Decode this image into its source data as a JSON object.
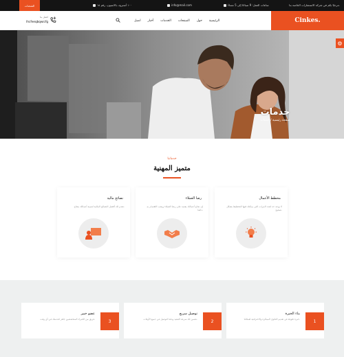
{
  "colors": {
    "accent": "#ea5121",
    "topbar": "#141414",
    "band": "#eef0f0"
  },
  "topbar": {
    "cta": "الشحنات",
    "address": "١٠٠ أسترود، بالاسيون، رقم ١٥",
    "email": "info@mail.com",
    "hours": "ساعات العمل: 9 صباحًا إلى 5 مساءً",
    "tagline": "مرحبًا بكم في شركة الاستشارات الخاصة بنا."
  },
  "header": {
    "brand": "Cinkes.",
    "nav": [
      "الرئيسية",
      "حول",
      "الصفحات",
      "الخدمات",
      "أخبار",
      "اتصل"
    ],
    "phone_label": "اتصل بنا",
    "phone": "Ihcfeeqbqwicfg"
  },
  "hero": {
    "title": "خدمات",
    "subtitle": "صفحة رئيسية / خدمات"
  },
  "services_section": {
    "tag": "خدماتنا",
    "title": "متميز المهنية",
    "items": [
      {
        "title": "مخطط الأعمال",
        "desc": "لا يوجد حد لعدد المرات التي يمكنك فيها التخطيط بشكل صحيح.",
        "icon": "bulb-icon"
      },
      {
        "title": "رضا العملاء",
        "desc": "إن نجاح أعمالك يعتمد على رضا العملاء ويجب الاهتمام به دائمًا.",
        "icon": "handshake-icon"
      },
      {
        "title": "نصائح مالية",
        "desc": "نقدم لك أفضل النصائح المالية لتنمية أعمالك بنجاح.",
        "icon": "presenter-icon"
      }
    ]
  },
  "features": [
    {
      "num": "1",
      "title": "بناء الخبرة",
      "desc": "خبرة طويلة في تقديم الحلول المبتكرة والاحترافية لعملائنا."
    },
    {
      "num": "2",
      "title": "توصيل سريع",
      "desc": "نضمن لك سرعة التنفيذ ودقة التوصيل في جميع الأوقات."
    },
    {
      "num": "3",
      "title": "عضو خبير",
      "desc": "فريق من الخبراء المتخصصين جاهز لخدمتك في أي وقت."
    }
  ]
}
